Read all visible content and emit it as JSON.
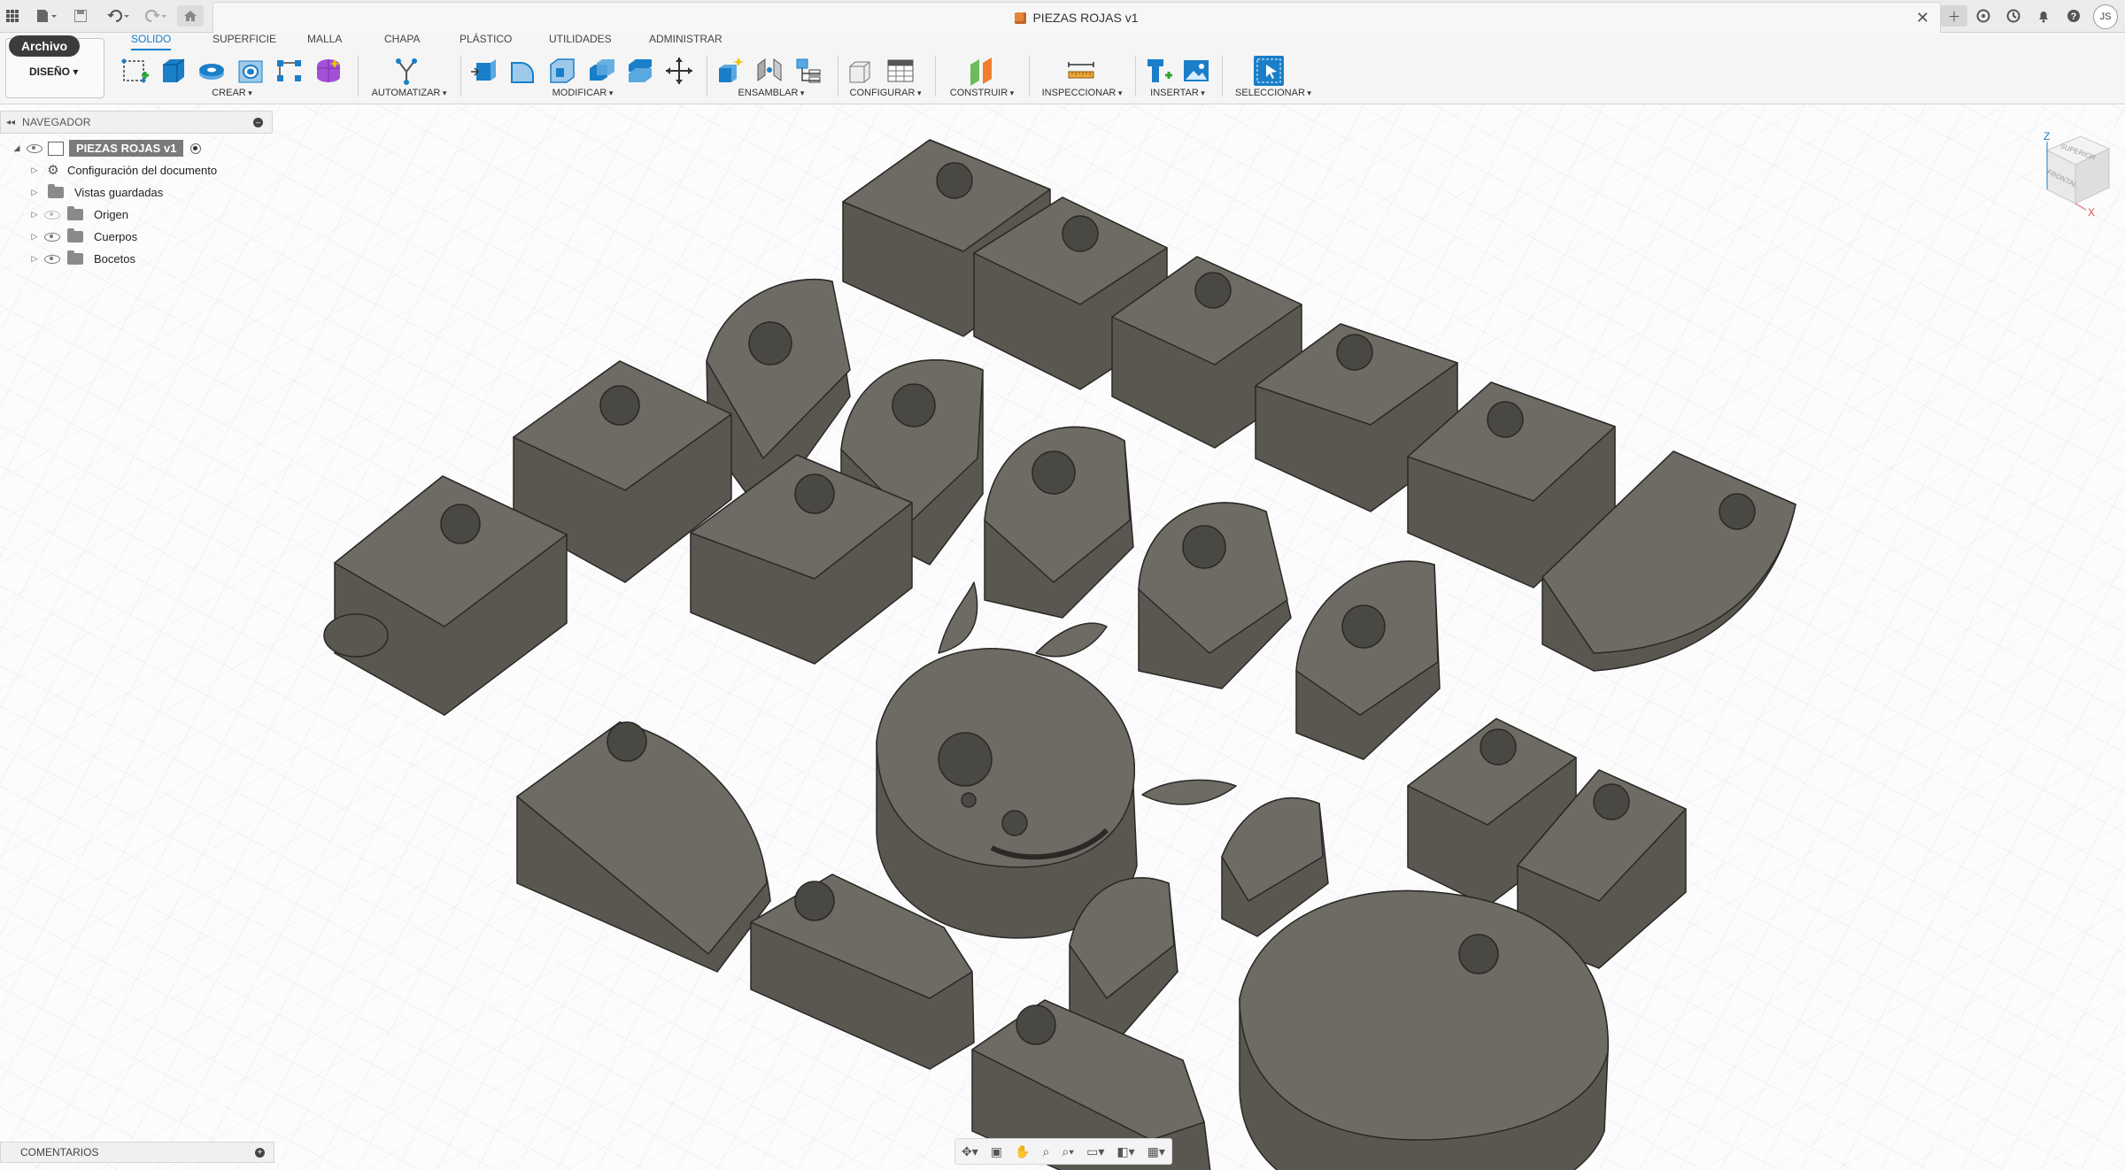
{
  "titlebar": {
    "document_title": "PIEZAS ROJAS v1",
    "user_initials": "JS",
    "icons": [
      "grid-icon",
      "file-icon",
      "save-icon",
      "undo-icon",
      "redo-icon",
      "home-icon",
      "close-icon",
      "new-tab-icon",
      "extensions-icon",
      "job-status-icon",
      "notifications-icon",
      "help-icon"
    ]
  },
  "toolbar": {
    "file_menu": "Archivo",
    "workspace": "DISEÑO",
    "tabs": [
      "SOLIDO",
      "SUPERFICIE",
      "MALLA",
      "CHAPA",
      "PLÁSTICO",
      "UTILIDADES",
      "ADMINISTRAR"
    ],
    "active_tab": "SOLIDO",
    "groups": {
      "crear": "CREAR",
      "automatizar": "AUTOMATIZAR",
      "modificar": "MODIFICAR",
      "ensamblar": "ENSAMBLAR",
      "configurar": "CONFIGURAR",
      "construir": "CONSTRUIR",
      "inspeccionar": "INSPECCIONAR",
      "insertar": "INSERTAR",
      "seleccionar": "SELECCIONAR"
    }
  },
  "browser": {
    "title": "NAVEGADOR",
    "root": "PIEZAS ROJAS v1",
    "items": [
      {
        "label": "Configuración del documento",
        "icon": "gear-icon",
        "eye": false
      },
      {
        "label": "Vistas guardadas",
        "icon": "folder-icon",
        "eye": false
      },
      {
        "label": "Origen",
        "icon": "folder-icon",
        "eye": true,
        "eye_hidden": true
      },
      {
        "label": "Cuerpos",
        "icon": "folder-icon",
        "eye": true
      },
      {
        "label": "Bocetos",
        "icon": "folder-icon",
        "eye": true
      }
    ]
  },
  "viewcube": {
    "top": "SUPERIOR",
    "front": "FRONTAL",
    "axis_z": "Z",
    "axis_x": "X"
  },
  "comments": {
    "title": "COMENTARIOS"
  },
  "colors": {
    "part_top": "#6e6b64",
    "part_side": "#5a5751",
    "part_edge": "#2a2926",
    "accent": "#1a7ec8",
    "grid": "#dde3ea"
  }
}
